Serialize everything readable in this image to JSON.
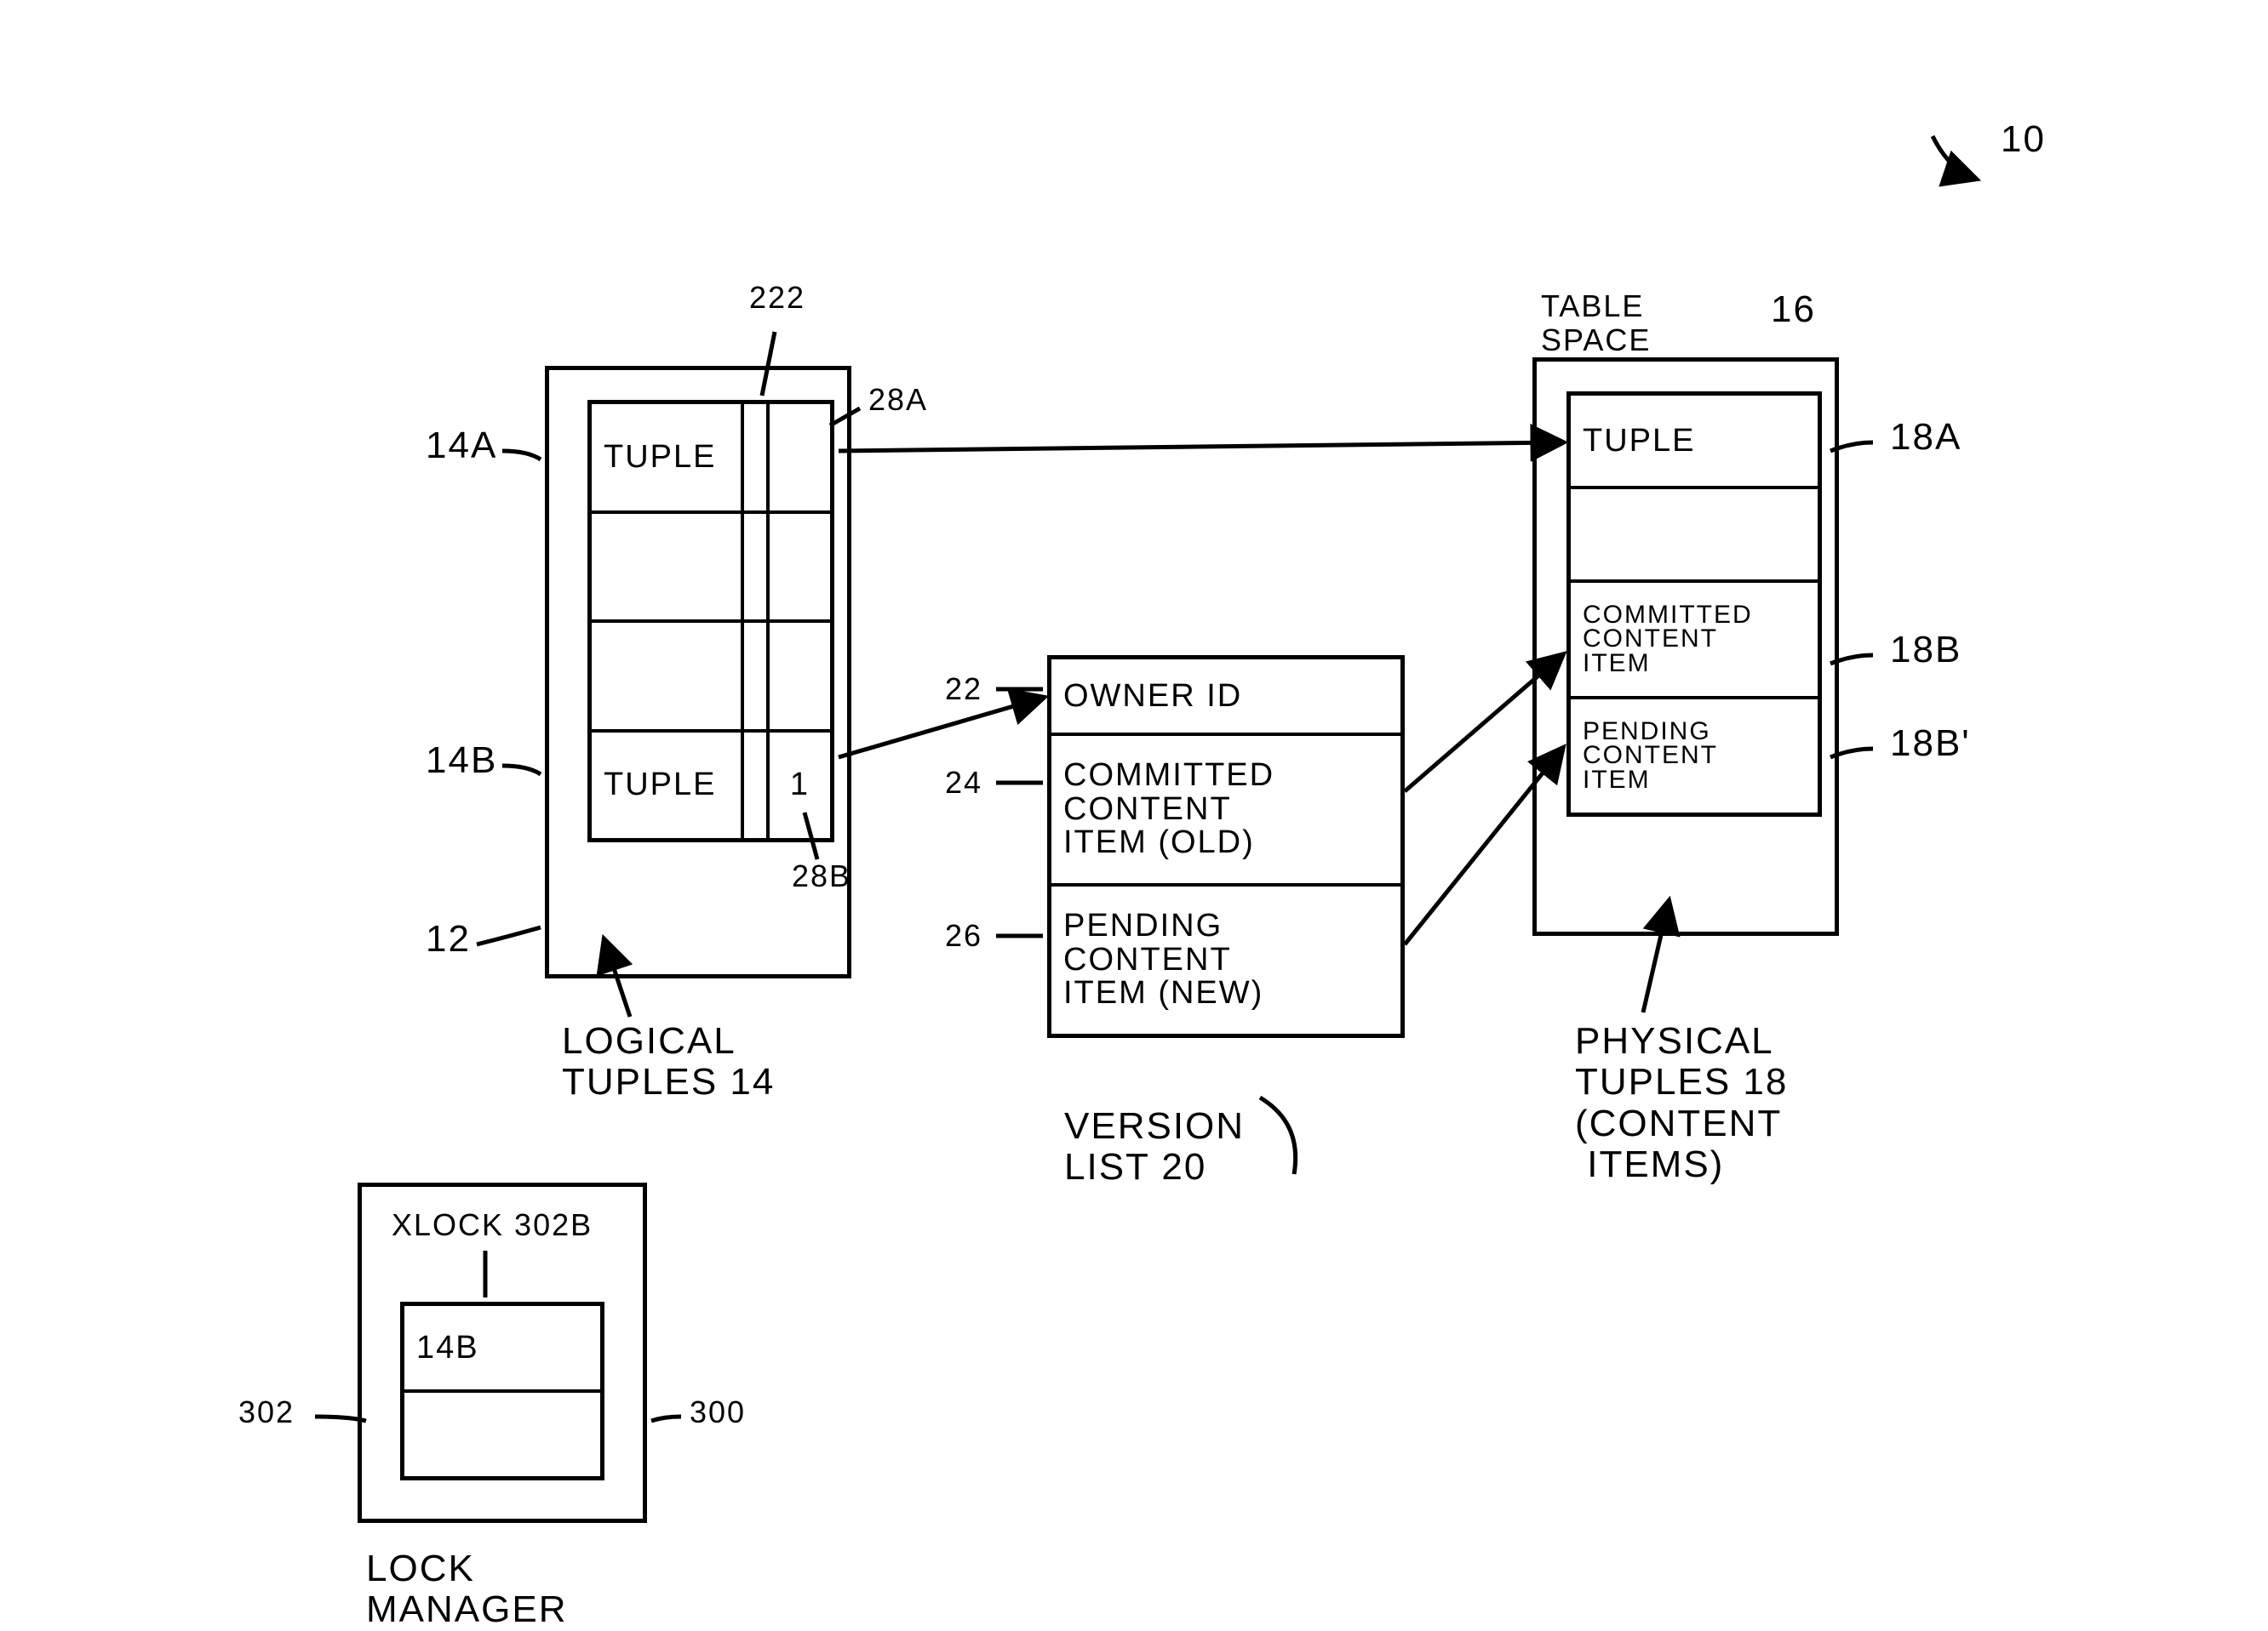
{
  "figure_ref": "10",
  "logical": {
    "container_ref": "12",
    "caption": "LOGICAL\nTUPLES 14",
    "rows": {
      "a": {
        "label": "TUPLE",
        "ref": "14A"
      },
      "b": {
        "label": "TUPLE",
        "ref": "14B",
        "version_count": "1"
      }
    },
    "version_col_ref": "222",
    "ptr_a_ref": "28A",
    "ptr_b_ref": "28B"
  },
  "version_list": {
    "caption": "VERSION\nLIST 20",
    "owner": {
      "label": "OWNER Id",
      "ref": "22"
    },
    "committed": {
      "label": "COMMITTED\nCONTENT\nITEM (OLD)",
      "ref": "24"
    },
    "pending": {
      "label": "PENDING\nCONTENT\nITEM (NEW)",
      "ref": "26"
    }
  },
  "physical": {
    "header": "TABLE\nSPACE",
    "container_ref": "16",
    "caption": "PHYSICAL\nTUPLES 18\n(CONTENT\n ITEMS)",
    "rows": {
      "a": {
        "label": "TUPLE",
        "ref": "18A"
      },
      "b": {
        "label": "COMMITTED\nCONTENT\nITEM",
        "ref": "18B"
      },
      "bp": {
        "label": "PENDING\nCONTENT\nITEM",
        "ref": "18B'"
      }
    }
  },
  "lock_manager": {
    "caption": "LOCK\nMANAGER",
    "container_ref": "300",
    "xlock_label": "XLOCK 302B",
    "locked_tuple": "14B",
    "list_ref": "302"
  }
}
